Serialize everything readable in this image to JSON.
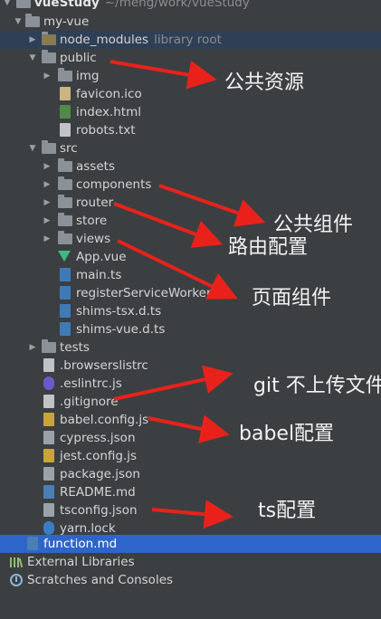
{
  "header": {
    "project": "vueStudy",
    "path": "~/meng/work/vueStudy"
  },
  "tree": {
    "root": "my-vue",
    "node_modules": {
      "name": "node_modules",
      "hint": "library root"
    },
    "public": {
      "name": "public",
      "children": [
        "img",
        "favicon.ico",
        "index.html",
        "robots.txt"
      ]
    },
    "src": {
      "name": "src",
      "children": [
        "assets",
        "components",
        "router",
        "store",
        "views",
        "App.vue",
        "main.ts",
        "registerServiceWorker.ts",
        "shims-tsx.d.ts",
        "shims-vue.d.ts"
      ]
    },
    "tests": "tests",
    "root_files": [
      ".browserslistrc",
      ".eslintrc.js",
      ".gitignore",
      "babel.config.js",
      "cypress.json",
      "jest.config.js",
      "package.json",
      "README.md",
      "tsconfig.json",
      "yarn.lock"
    ],
    "selected": "function.md"
  },
  "bottom": {
    "external_libraries": "External Libraries",
    "scratches": "Scratches and Consoles"
  },
  "annotations": {
    "public": "公共资源",
    "components": "公共组件",
    "router": "路由配置",
    "views": "页面组件",
    "gitignore": "git 不上传文件",
    "babel": "babel配置",
    "tsconfig": "ts配置"
  },
  "colors": {
    "background": "#3c3f41",
    "selection": "#2e65ca",
    "arrow": "#e8221b"
  }
}
